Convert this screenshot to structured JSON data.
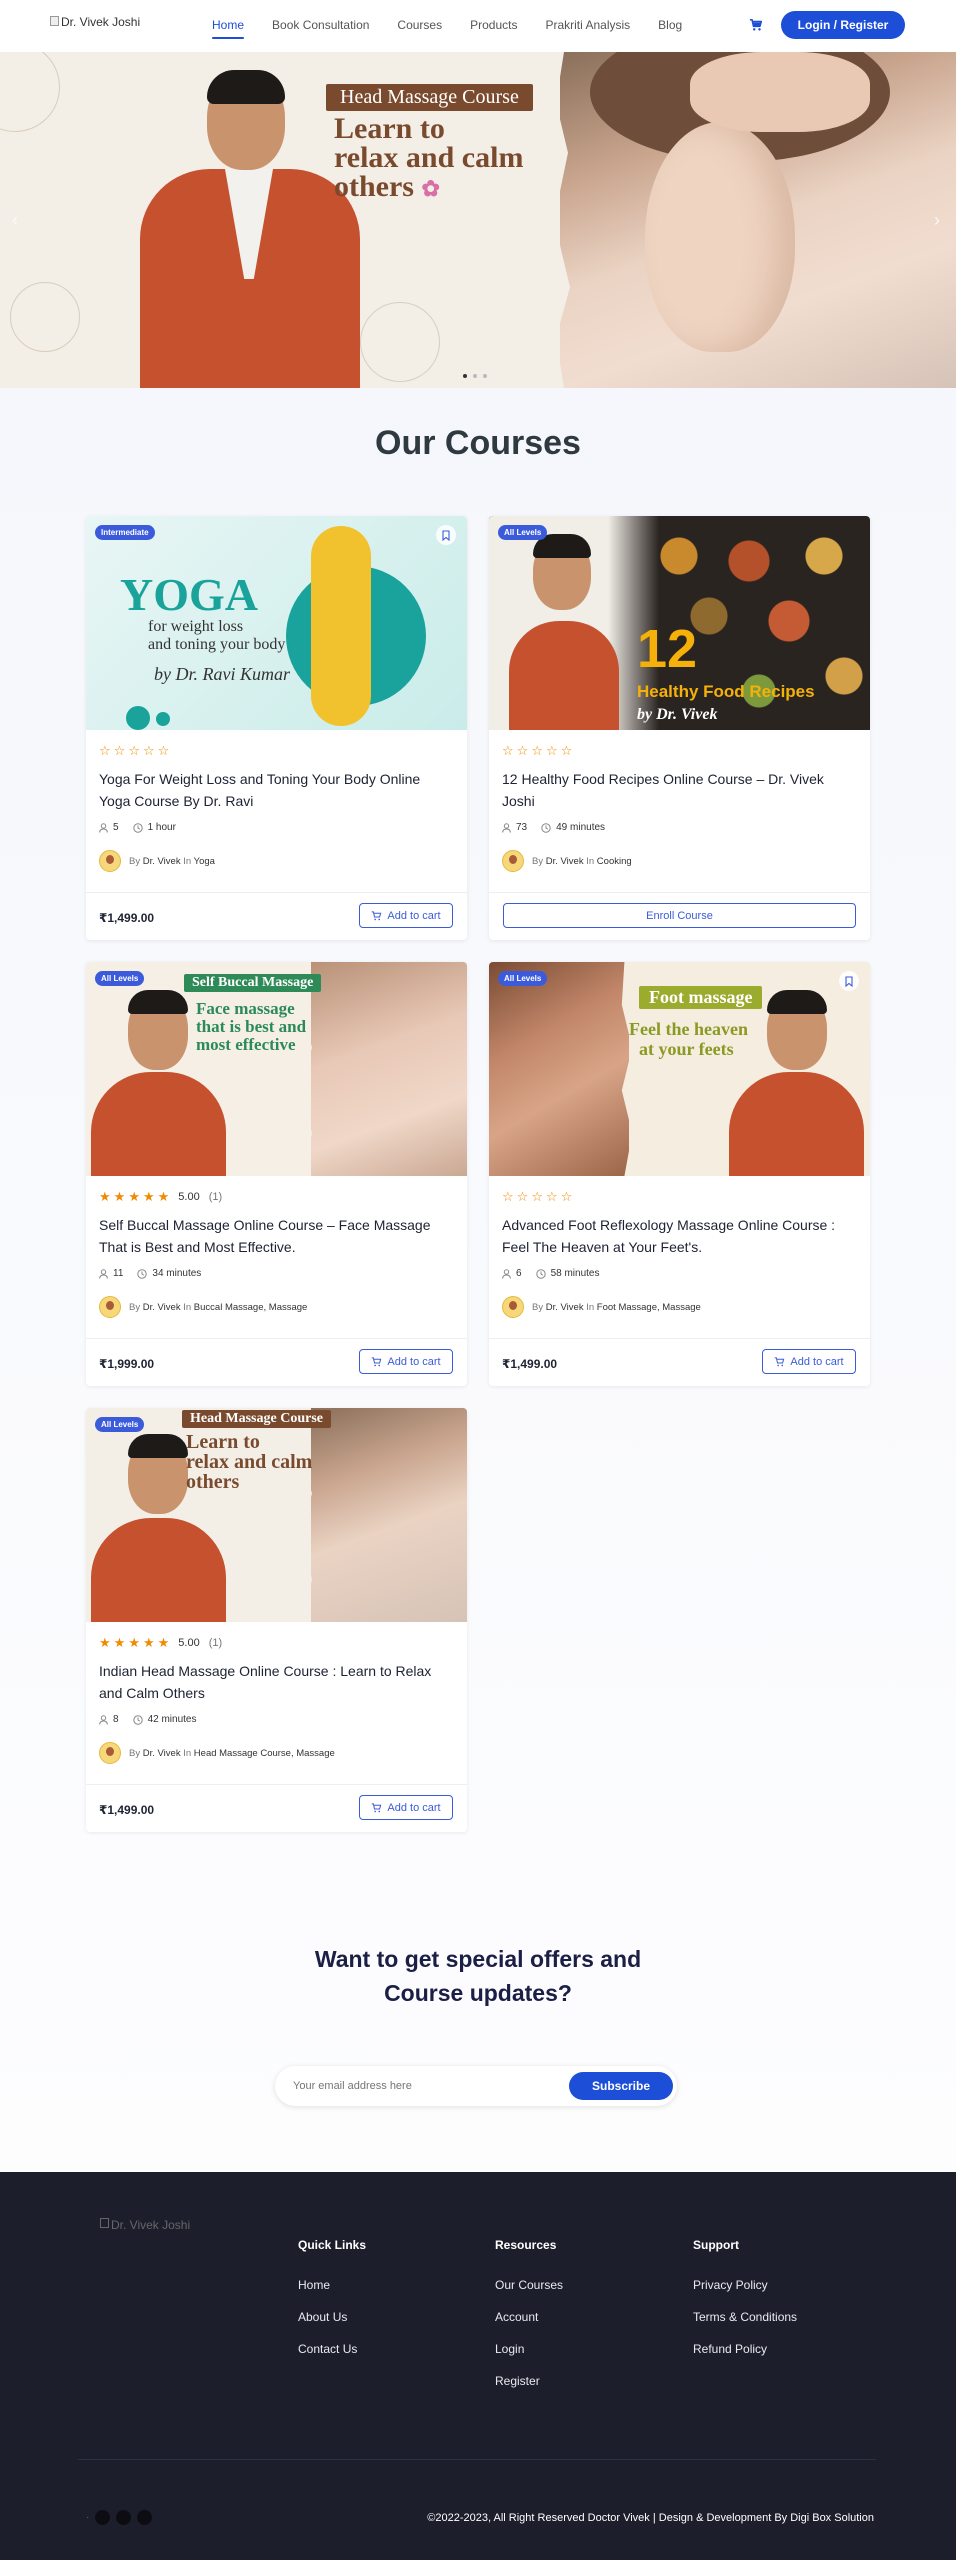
{
  "nav": {
    "logo_alt": "Dr. Vivek Joshi",
    "items": [
      "Home",
      "Book Consultation",
      "Courses",
      "Products",
      "Prakriti Analysis",
      "Blog"
    ],
    "active": "Home",
    "login_label": "Login / Register"
  },
  "hero": {
    "tag": "Head Massage Course",
    "title_lines": [
      "Learn to",
      "relax and calm",
      "others"
    ],
    "slides": 3,
    "active_slide": 1
  },
  "courses": {
    "heading": "Our Courses",
    "items": [
      {
        "badge": "Intermediate",
        "thumb_text": [
          "YOGA",
          "for weight loss",
          "and toning your body",
          "by Dr. Ravi Kumar"
        ],
        "rating": 0,
        "rating_value": "",
        "rating_count": "",
        "title": "Yoga For Weight Loss and Toning Your Body Online Yoga Course By Dr. Ravi",
        "students": "5",
        "duration": "1 hour",
        "by": "By",
        "author": "Dr. Vivek",
        "in": "In",
        "category": "Yoga",
        "price": "₹1,499.00",
        "action": "Add to cart"
      },
      {
        "badge": "All Levels",
        "thumb_text": [
          "12",
          "Healthy Food Recipes",
          "by Dr. Vivek"
        ],
        "rating": 0,
        "rating_value": "",
        "rating_count": "",
        "title": "12 Healthy Food Recipes Online Course – Dr. Vivek Joshi",
        "students": "73",
        "duration": "49 minutes",
        "by": "By",
        "author": "Dr. Vivek",
        "in": "In",
        "category": "Cooking",
        "price": "",
        "action": "Enroll Course"
      },
      {
        "badge": "All Levels",
        "thumb_text": [
          "Self Buccal Massage",
          "Face massage",
          "that is best and",
          "most effective"
        ],
        "rating": 5,
        "rating_value": "5.00",
        "rating_count": "(1)",
        "title": "Self Buccal Massage Online Course – Face Massage That is Best and Most Effective.",
        "students": "11",
        "duration": "34 minutes",
        "by": "By",
        "author": "Dr. Vivek",
        "in": "In",
        "category": "Buccal Massage, Massage",
        "price": "₹1,999.00",
        "action": "Add to cart"
      },
      {
        "badge": "All Levels",
        "thumb_text": [
          "Foot massage",
          "Feel the heaven",
          "at your feets"
        ],
        "rating": 0,
        "rating_value": "",
        "rating_count": "",
        "title": "Advanced Foot Reflexology Massage Online Course : Feel The Heaven at Your Feet's.",
        "students": "6",
        "duration": "58 minutes",
        "by": "By",
        "author": "Dr. Vivek",
        "in": "In",
        "category": "Foot Massage, Massage",
        "price": "₹1,499.00",
        "action": "Add to cart"
      },
      {
        "badge": "All Levels",
        "thumb_text": [
          "Head Massage Course",
          "Learn to",
          "relax and calm",
          "others"
        ],
        "rating": 5,
        "rating_value": "5.00",
        "rating_count": "(1)",
        "title": "Indian Head Massage Online Course : Learn to Relax and Calm Others",
        "students": "8",
        "duration": "42 minutes",
        "by": "By",
        "author": "Dr. Vivek",
        "in": "In",
        "category": "Head Massage Course, Massage",
        "price": "₹1,499.00",
        "action": "Add to cart"
      }
    ]
  },
  "newsletter": {
    "heading_line1": "Want to get special offers and",
    "heading_line2": "Course updates?",
    "placeholder": "Your email address here",
    "button": "Subscribe"
  },
  "footer": {
    "logo_alt": "Dr. Vivek Joshi",
    "columns": [
      {
        "title": "Quick Links",
        "links": [
          "Home",
          "About Us",
          "Contact Us"
        ]
      },
      {
        "title": "Resources",
        "links": [
          "Our Courses",
          "Account",
          "Login",
          "Register"
        ]
      },
      {
        "title": "Support",
        "links": [
          "Privacy Policy",
          "Terms & Conditions",
          "Refund Policy"
        ]
      }
    ],
    "social": [
      "facebook-icon",
      "instagram-icon",
      "youtube-icon"
    ],
    "copyright": "©2022-2023, All Right Reserved Doctor Vivek | Design & Development By Digi Box Solution"
  },
  "colors": {
    "primary": "#1d4ed8",
    "badge": "#3b5bdb",
    "star": "#f08a00",
    "footer_bg": "#1d1e2c",
    "hero_brown": "#7a4a2e"
  }
}
